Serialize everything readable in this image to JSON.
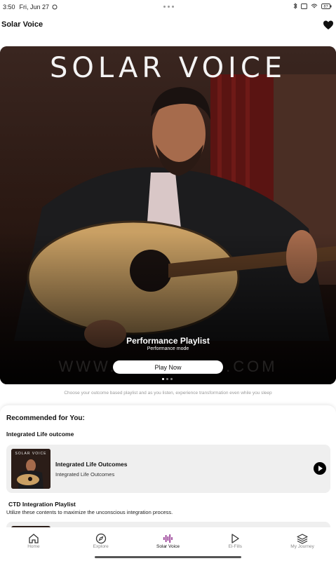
{
  "status_bar": {
    "time": "3:50",
    "date": "Fri, Jun 27",
    "battery": "87"
  },
  "header": {
    "title": "Solar Voice",
    "favorite_icon": "heart-icon"
  },
  "hero": {
    "brand": "SOLAR VOICE",
    "watermark": "WWW.AMRSOLAR.COM",
    "title": "Performance Playlist",
    "subtitle": "Performance mode",
    "button_label": "Play Now",
    "carousel_count": 3,
    "carousel_active": 1
  },
  "caption": "Choose your outcome based playlist and as you listen, experience transformation even while you sleep",
  "recommended": {
    "heading": "Recommended for You:",
    "groups": [
      {
        "title": "Integrated Life outcome",
        "card": {
          "thumb_text": "SOLAR VOICE",
          "title": "Integrated Life Outcomes",
          "subtitle": "Integrated Life Outcomes"
        }
      },
      {
        "title": "CTD Integration Playlist",
        "description": "Utilize these contents to maximize the unconscious integration process."
      }
    ]
  },
  "nav": {
    "items": [
      {
        "label": "Home",
        "icon": "home-icon"
      },
      {
        "label": "Explore",
        "icon": "compass-icon"
      },
      {
        "label": "Solar Voice",
        "icon": "waveform-icon"
      },
      {
        "label": "El-Fills",
        "icon": "play-icon"
      },
      {
        "label": "My Journey",
        "icon": "layers-icon"
      }
    ],
    "active_index": 2,
    "accent_color": "#8e2a8c"
  }
}
